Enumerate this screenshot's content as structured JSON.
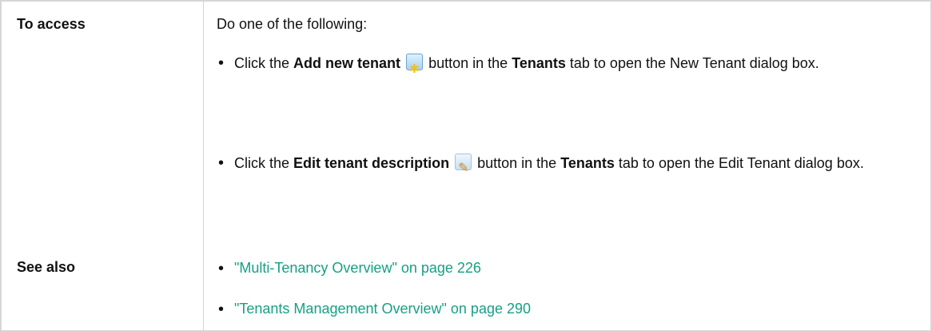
{
  "table": {
    "row1": {
      "label": "To access",
      "intro": "Do one of the following:",
      "bullets": [
        {
          "pre": "Click the",
          "bold": "Add new tenant",
          "icon": "add-new-tenant-icon",
          "mid": "button in the",
          "bold2": "Tenants",
          "post_line1": "tab to open the New",
          "post_line2": "Tenant dialog box."
        },
        {
          "pre": "Click the",
          "bold": "Edit tenant description",
          "icon": "edit-tenant-description-icon",
          "mid": "button in the",
          "bold2": "Tenants",
          "post_line1": "tab to open",
          "post_line2": "the Edit Tenant dialog box."
        }
      ]
    },
    "row2": {
      "label": "See also",
      "links": [
        "\"Multi-Tenancy Overview\" on page 226",
        "\"Tenants Management Overview\" on page 290"
      ],
      "link_color": "#16a085"
    }
  }
}
